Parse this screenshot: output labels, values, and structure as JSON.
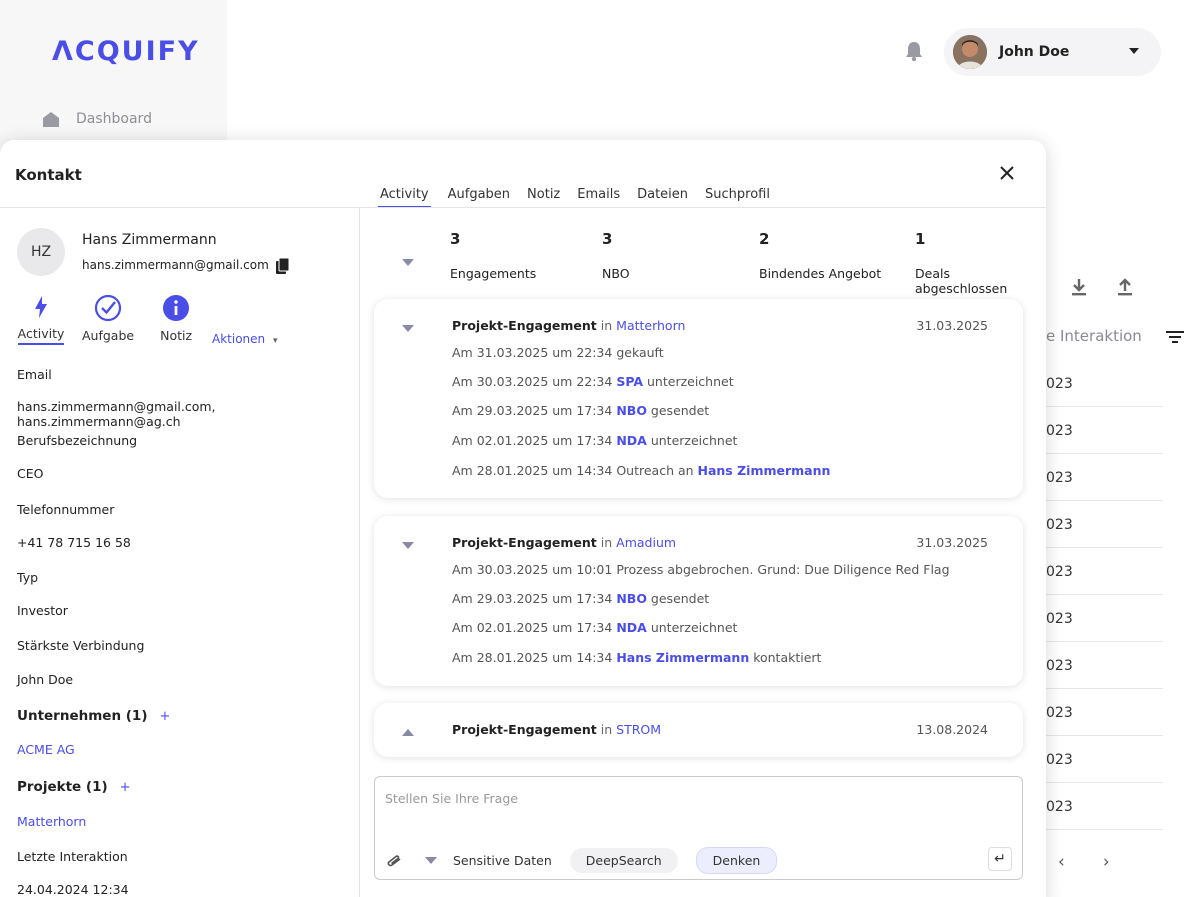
{
  "app": {
    "logo": "ΛCQUIFY"
  },
  "sidebar": {
    "dashboard_label": "Dashboard"
  },
  "header": {
    "user_name": "John Doe"
  },
  "background_table": {
    "column_header": "e Interaktion",
    "rows": [
      "023",
      "023",
      "023",
      "023",
      "023",
      "023",
      "023",
      "023",
      "023",
      "023"
    ],
    "prev": "‹",
    "next": "›"
  },
  "modal": {
    "title": "Kontakt",
    "close": "✕",
    "tabs": [
      "Activity",
      "Aufgaben",
      "Notiz",
      "Emails",
      "Dateien",
      "Suchprofil"
    ],
    "contact": {
      "initials": "HZ",
      "name": "Hans Zimmermann",
      "email": "hans.zimmermann@gmail.com"
    },
    "actions": {
      "activity": "Activity",
      "task": "Aufgabe",
      "note": "Notiz",
      "more": "Aktionen",
      "more_caret": "▾"
    },
    "fields": {
      "email_label": "Email",
      "email_value": "hans.zimmermann@gmail.com, hans.zimmermann@ag.ch",
      "job_label": "Berufsbezeichnung",
      "job_value": "CEO",
      "phone_label": "Telefonnummer",
      "phone_value": "+41 78 715 16 58",
      "type_label": "Typ",
      "type_value": "Investor",
      "conn_label": "Stärkste Verbindung",
      "conn_value": "John Doe",
      "companies_head": "Unternehmen (1)",
      "companies_value": "ACME AG",
      "projects_head": "Projekte (1)",
      "projects_value": "Matterhorn",
      "last_label": "Letzte Interaktion",
      "last_value": "24.04.2024 12:34",
      "plus": "+"
    },
    "stats": [
      {
        "value": "3",
        "label": "Engagements"
      },
      {
        "value": "3",
        "label": "NBO"
      },
      {
        "value": "2",
        "label": "Bindendes Angebot"
      },
      {
        "value": "1",
        "label": "Deals abgeschlossen"
      }
    ],
    "engagements": [
      {
        "title": "Projekt-Engagement",
        "in": "in",
        "project": "Matterhorn",
        "date": "31.03.2025",
        "lines": [
          {
            "pre": "Am 31.03.2025 um 22:34 gekauft",
            "hl": "",
            "post": ""
          },
          {
            "pre": "Am 30.03.2025 um 22:34 ",
            "hl": "SPA",
            "post": " unterzeichnet"
          },
          {
            "pre": "Am 29.03.2025 um 17:34 ",
            "hl": "NBO",
            "post": " gesendet"
          },
          {
            "pre": "Am 02.01.2025 um 17:34 ",
            "hl": "NDA",
            "post": " unterzeichnet"
          },
          {
            "pre": "Am 28.01.2025 um 14:34 Outreach an ",
            "hl": "Hans Zimmermann",
            "post": ""
          }
        ]
      },
      {
        "title": "Projekt-Engagement",
        "in": "in",
        "project": "Amadium",
        "date": "31.03.2025",
        "lines": [
          {
            "pre": "Am 30.03.2025 um 10:01 Prozess abgebrochen. Grund: Due Diligence Red Flag",
            "hl": "",
            "post": ""
          },
          {
            "pre": "Am 29.03.2025 um 17:34 ",
            "hl": "NBO",
            "post": " gesendet"
          },
          {
            "pre": "Am 02.01.2025 um 17:34 ",
            "hl": "NDA",
            "post": " unterzeichnet"
          },
          {
            "pre": "Am 28.01.2025 um 14:34 ",
            "hl": "Hans Zimmermann",
            "post": " kontaktiert"
          }
        ]
      },
      {
        "title": "Projekt-Engagement",
        "in": "in",
        "project": "STROM",
        "date": "13.08.2024",
        "lines": []
      }
    ],
    "chat": {
      "placeholder": "Stellen Sie Ihre Frage",
      "sensitive": "Sensitive Daten",
      "deepsearch": "DeepSearch",
      "think": "Denken",
      "enter": "↵"
    }
  },
  "colors": {
    "accent": "#4a4ee6"
  }
}
